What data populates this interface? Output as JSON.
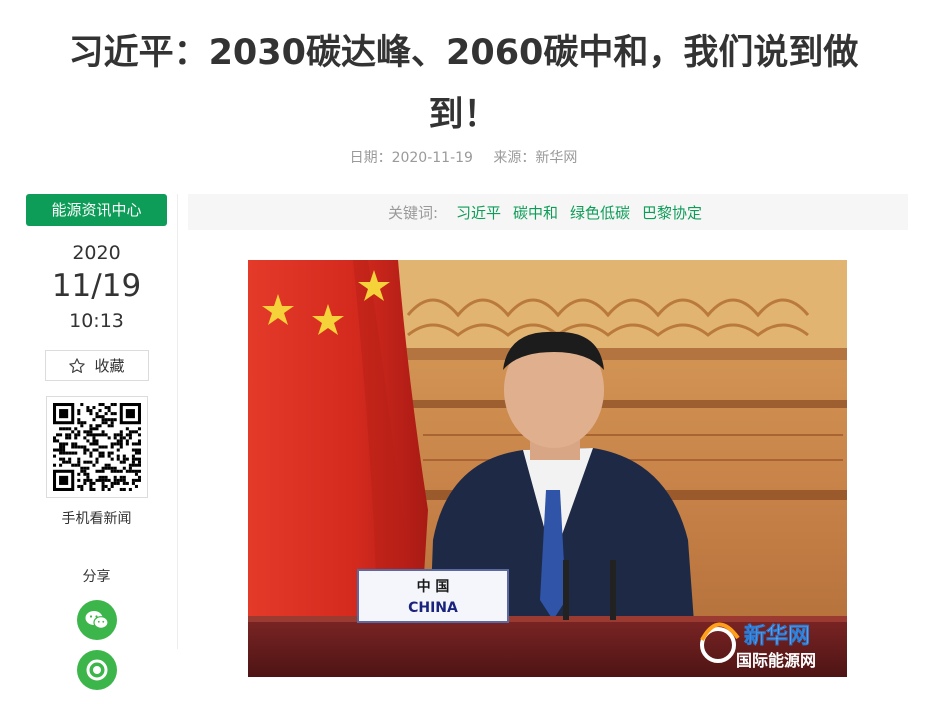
{
  "article": {
    "title": "习近平：2030碳达峰、2060碳中和，我们说到做到！",
    "date_label": "日期：2020-11-19",
    "source_label": "来源：新华网"
  },
  "rail": {
    "channel": "能源资讯中心",
    "year": "2020",
    "day": "11/19",
    "time": "10:13",
    "favorite": "收藏",
    "qr_caption": "手机看新闻",
    "share_label": "分享"
  },
  "keywords": {
    "label": "关键词:",
    "items": [
      "习近平",
      "碳中和",
      "绿色低碳",
      "巴黎协定"
    ]
  },
  "photo": {
    "nameplate_cn": "中 国",
    "nameplate_en": "CHINA",
    "watermark_xinhua": "新华网",
    "watermark_site": "国际能源网"
  },
  "colors": {
    "brand_green": "#0e9d58",
    "share_green": "#3cb54a",
    "flag_red": "#d42a1e"
  },
  "icons": [
    "star-icon",
    "qr-code",
    "wechat-icon",
    "moments-icon"
  ]
}
